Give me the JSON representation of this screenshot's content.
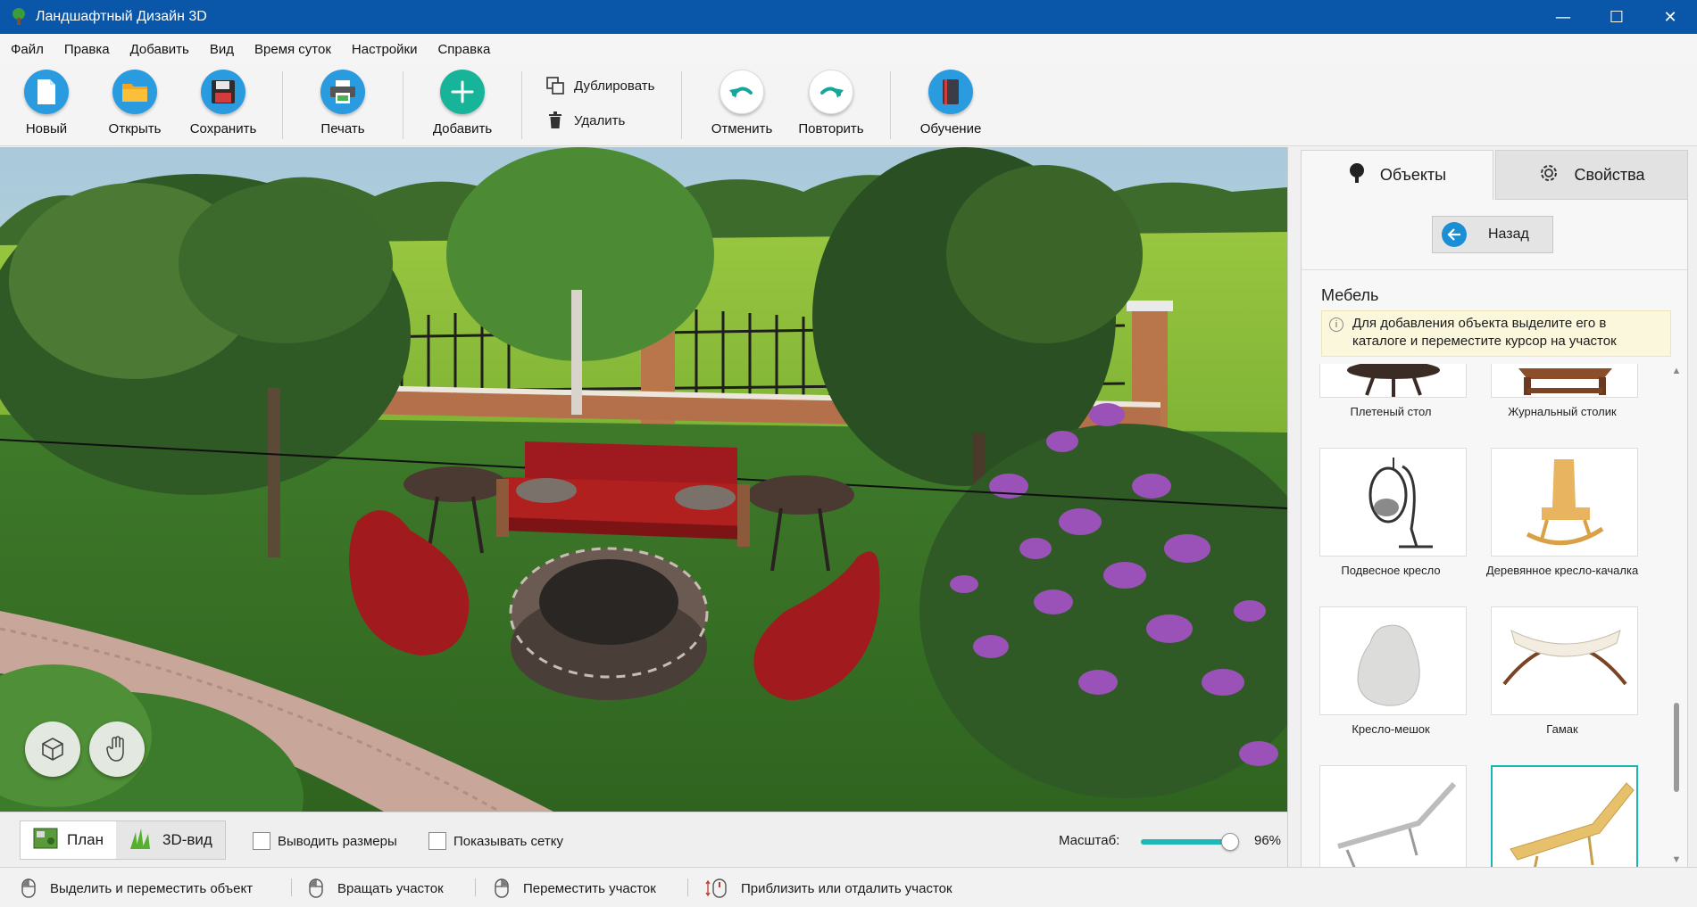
{
  "window": {
    "title": "Ландшафтный Дизайн 3D",
    "controls": {
      "minimize": "—",
      "maximize": "☐",
      "close": "✕"
    }
  },
  "menu": [
    "Файл",
    "Правка",
    "Добавить",
    "Вид",
    "Время суток",
    "Настройки",
    "Справка"
  ],
  "toolbar": {
    "new_label": "Новый",
    "open_label": "Открыть",
    "save_label": "Сохранить",
    "print_label": "Печать",
    "add_label": "Добавить",
    "duplicate_label": "Дублировать",
    "delete_label": "Удалить",
    "undo_label": "Отменить",
    "redo_label": "Повторить",
    "learn_label": "Обучение"
  },
  "viewbar": {
    "plan_label": "План",
    "view3d_label": "3D-вид",
    "active_view": "3D-вид",
    "show_dimensions_label": "Выводить размеры",
    "show_dimensions_checked": false,
    "show_grid_label": "Показывать сетку",
    "show_grid_checked": false,
    "zoom_label": "Масштаб:",
    "zoom_value": "96%",
    "zoom_level": 0.96
  },
  "statusbar": {
    "select_hint": "Выделить и переместить объект",
    "rotate_hint": "Вращать участок",
    "move_hint": "Переместить участок",
    "zoom_hint": "Приблизить или отдалить участок"
  },
  "panel": {
    "tab_objects": "Объекты",
    "tab_properties": "Свойства",
    "active_tab": "Объекты",
    "back_label": "Назад",
    "category": "Мебель",
    "info_text": "Для добавления объекта выделите его в каталоге и переместите курсор на участок",
    "items": [
      {
        "name": "Плетеный стол",
        "icon": "wicker-table"
      },
      {
        "name": "Журнальный столик",
        "icon": "coffee-table"
      },
      {
        "name": "Подвесное кресло",
        "icon": "hanging-chair"
      },
      {
        "name": "Деревянное кресло-качалка",
        "icon": "rocking-chair"
      },
      {
        "name": "Кресло-мешок",
        "icon": "bean-bag"
      },
      {
        "name": "Гамак",
        "icon": "hammock"
      },
      {
        "name": "",
        "icon": "lounger-white"
      },
      {
        "name": "",
        "icon": "lounger-wood"
      }
    ],
    "selected_item": 7
  },
  "colors": {
    "titlebar": "#0a56a8",
    "accent": "#19b7b2",
    "back_icon": "#1a8fd6"
  }
}
